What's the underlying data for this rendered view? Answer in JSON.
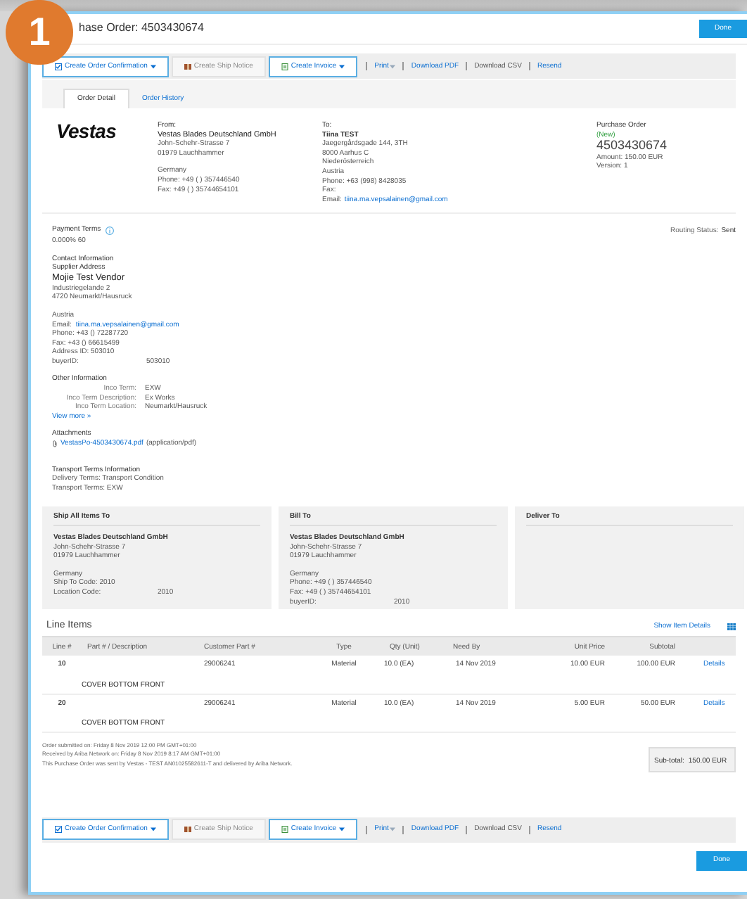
{
  "badge": "1",
  "header": {
    "title": "hase Order: 4503430674",
    "done": "Done"
  },
  "top_toolbar": {
    "buttons": [
      {
        "label": "Create Order Confirmation",
        "kind": "confirm",
        "dropdown": true,
        "disabled": false
      },
      {
        "label": "Create Ship Notice",
        "kind": "ship",
        "dropdown": false,
        "disabled": true
      },
      {
        "label": "Create Invoice",
        "kind": "invoice",
        "dropdown": true,
        "disabled": false
      }
    ],
    "links": [
      {
        "label": "Print",
        "dropdown": true,
        "disabled": false
      },
      {
        "label": "Download PDF",
        "dropdown": false,
        "disabled": false
      },
      {
        "label": "Download CSV",
        "dropdown": false,
        "disabled": true
      },
      {
        "label": "Resend",
        "dropdown": false,
        "disabled": false
      }
    ]
  },
  "tabs": [
    {
      "label": "Order Detail",
      "selected": true
    },
    {
      "label": "Order History",
      "selected": false
    }
  ],
  "logo": "Vestas",
  "from": {
    "heading": "From:",
    "name": "Vestas Blades Deutschland GmbH",
    "blocks": [
      [
        "John-Schehr-Strasse 7",
        "01979 Lauchhammer"
      ],
      [
        "Germany",
        "Phone:  +49 ( ) 357446540",
        "Fax:  +49 ( ) 35744654101"
      ]
    ]
  },
  "to": {
    "heading": "To:",
    "name": "Tiina TEST",
    "lines": [
      "Jaegergårdsgade 144, 3TH",
      "8000 Aarhus C",
      "Niederösterreich",
      "Austria",
      "Phone: +63 (998) 8428035",
      "Fax:"
    ],
    "email_label": "Email:",
    "email": "tiina.ma.vepsalainen@gmail.com"
  },
  "purchase_order": {
    "heading": "Purchase Order",
    "status": "(New)",
    "number": "4503430674",
    "lines": [
      "Amount:  150.00 EUR",
      "Version:  1"
    ]
  },
  "payment_terms": {
    "label": "Payment Terms",
    "value": "0.000% 60"
  },
  "routing_status": {
    "label": "Routing Status:",
    "value": "Sent"
  },
  "contact": {
    "heading": "Contact Information",
    "subheading": "Supplier Address",
    "name": "Mojie Test Vendor",
    "lines": [
      "Industriegelande 2",
      "4720 Neumarkt/Hausruck"
    ],
    "country": "Austria",
    "email_label": "Email:",
    "email": "tiina.ma.vepsalainen@gmail.com",
    "lines2": [
      "Phone:  +43 () 72287720",
      "Fax:  +43 () 66615499",
      "Address ID:  503010"
    ],
    "buyer_label": "buyerID:",
    "buyer_value": "503010"
  },
  "other_info": {
    "heading": "Other Information",
    "rows": [
      {
        "label": "Inco Term:",
        "value": "EXW"
      },
      {
        "label": "Inco Term Description:",
        "value": "Ex Works"
      },
      {
        "label": "Inco Term Location:",
        "value": "Neumarkt/Hausruck"
      }
    ],
    "more": "View more »"
  },
  "attachments": {
    "heading": "Attachments",
    "file": "VestasPo-4503430674.pdf",
    "type": "(application/pdf)"
  },
  "transport": {
    "heading": "Transport Terms Information",
    "lines": [
      "Delivery Terms: Transport Condition",
      "Transport Terms: EXW"
    ]
  },
  "address_cards": [
    {
      "title": "Ship All Items To",
      "name": "Vestas Blades Deutschland GmbH",
      "lines": [
        "John-Schehr-Strasse 7",
        "01979 Lauchhammer"
      ],
      "lines2": [
        "Germany",
        "Ship To Code:  2010"
      ],
      "kv": [
        {
          "label": "Location Code:",
          "value": "2010"
        }
      ]
    },
    {
      "title": "Bill To",
      "name": "Vestas Blades Deutschland GmbH",
      "lines": [
        "John-Schehr-Strasse 7",
        "01979 Lauchhammer"
      ],
      "lines2": [
        "Germany",
        "Phone:  +49 ( ) 357446540",
        "Fax:  +49 ( ) 35744654101"
      ],
      "kv": [
        {
          "label": "buyerID:",
          "value": "2010"
        }
      ]
    },
    {
      "title": "Deliver To"
    }
  ],
  "line_items": {
    "title": "Line Items",
    "show_details": "Show Item Details",
    "columns": [
      "Line #",
      "Part # / Description",
      "Customer Part #",
      "Type",
      "Qty (Unit)",
      "Need By",
      "Unit Price",
      "Subtotal"
    ],
    "rows": [
      {
        "line": "10",
        "customer_part": "29006241",
        "type": "Material",
        "qty": "10.0 (EA)",
        "need_by": "14 Nov 2019",
        "unit_price": "10.00 EUR",
        "subtotal": "100.00 EUR",
        "action": "Details",
        "description": "COVER BOTTOM FRONT"
      },
      {
        "line": "20",
        "customer_part": "29006241",
        "type": "Material",
        "qty": "10.0 (EA)",
        "need_by": "14 Nov 2019",
        "unit_price": "5.00 EUR",
        "subtotal": "50.00 EUR",
        "action": "Details",
        "description": "COVER BOTTOM FRONT"
      }
    ]
  },
  "notes": [
    "Order submitted on: Friday 8 Nov 2019 12:00 PM GMT+01:00",
    "Received by Ariba Network on: Friday 8 Nov 2019 8:17 AM GMT+01:00",
    "This Purchase Order was sent by Vestas - TEST AN01025582611-T and delivered by Ariba Network."
  ],
  "subtotal": {
    "label": "Sub-total:",
    "value": "150.00 EUR"
  },
  "bottom_toolbar": {
    "buttons": [
      {
        "label": "Create Order Confirmation",
        "kind": "confirm",
        "dropdown": true,
        "disabled": false
      },
      {
        "label": "Create Ship Notice",
        "kind": "ship",
        "dropdown": false,
        "disabled": true
      },
      {
        "label": "Create Invoice",
        "kind": "invoice",
        "dropdown": true,
        "disabled": false
      }
    ],
    "links": [
      {
        "label": "Print",
        "dropdown": true,
        "disabled": false
      },
      {
        "label": "Download PDF",
        "dropdown": false,
        "disabled": false
      },
      {
        "label": "Download CSV",
        "dropdown": false,
        "disabled": true
      },
      {
        "label": "Resend",
        "dropdown": false,
        "disabled": false
      }
    ]
  },
  "footer": {
    "done": "Done"
  }
}
